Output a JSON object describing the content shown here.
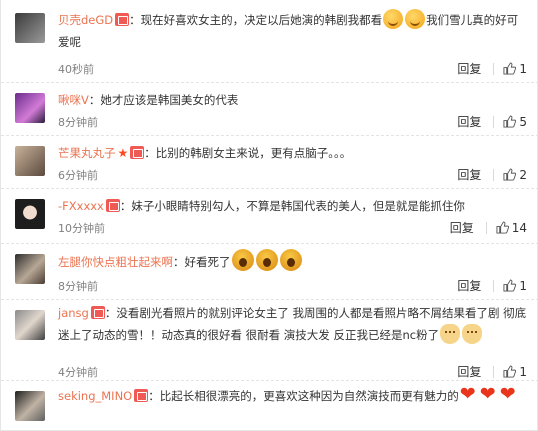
{
  "comments": [
    {
      "user": "贝壳deGD",
      "text_a": "：现在好喜欢女主的，决定以后她演的韩剧我都看",
      "text_b": "我们雪儿真的好可爱呢",
      "time": "40秒前",
      "reply": "回复",
      "likes": "1",
      "emojis": [
        "grin",
        "grin"
      ]
    },
    {
      "user": "啾咪V",
      "text_a": "：她才应该是韩国美女的代表",
      "time": "8分钟前",
      "reply": "回复",
      "likes": "5"
    },
    {
      "user": "芒果丸丸子",
      "text_a": "：比别的韩剧女主来说，更有点脑子。。。",
      "time": "6分钟前",
      "reply": "回复",
      "likes": "2"
    },
    {
      "user": "-FXxxxx",
      "text_a": "：妹子小眼睛特别勾人，不算是韩国代表的美人，但是就是能抓住你",
      "time": "10分钟前",
      "reply": "回复",
      "likes": "14"
    },
    {
      "user": "左腿你快点粗壮起来啊",
      "text_a": "：好看死了",
      "time": "8分钟前",
      "reply": "回复",
      "likes": "1",
      "emojis": [
        "shock",
        "shock",
        "shock"
      ]
    },
    {
      "user": "jansg",
      "text_a": "：没看剧光看照片的就别评论女主了 我周围的人都是看照片略不屑结果看了剧 彻底迷上了动态的雪！！动态真的很好看 很耐看 演技大发 反正我已经是nc粉了",
      "time": "4分钟前",
      "reply": "回复",
      "likes": "1",
      "emojis": [
        "cat",
        "cat"
      ]
    },
    {
      "user": "seking_MINO",
      "text_a": "：比起长相很漂亮的，更喜欢这种因为自然演技而更有魅力的",
      "emojis": [
        "heart",
        "heart",
        "heart"
      ]
    }
  ]
}
